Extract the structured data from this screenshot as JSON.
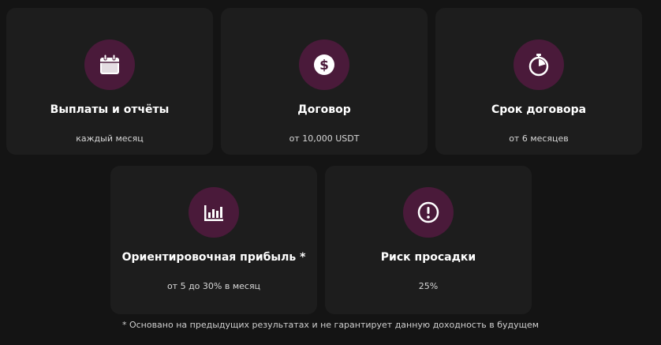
{
  "cards": [
    {
      "icon": "calendar-icon",
      "title": "Выплаты и отчёты",
      "subtitle": "каждый месяц"
    },
    {
      "icon": "dollar-coin-icon",
      "title": "Договор",
      "subtitle": "от 10,000 USDT"
    },
    {
      "icon": "stopwatch-icon",
      "title": "Срок договора",
      "subtitle": "от 6 месяцев"
    },
    {
      "icon": "bar-chart-icon",
      "title": "Ориентировочная прибыль *",
      "subtitle": "от 5 до 30% в месяц"
    },
    {
      "icon": "exclamation-icon",
      "title": "Риск просадки",
      "subtitle": "25%"
    }
  ],
  "footnote": "* Основано на предыдущих результатах и не гарантирует данную доходность в будущем",
  "colors": {
    "background": "#141414",
    "card": "#1d1d1d",
    "badge": "#4a1a3a",
    "text": "#ffffff"
  }
}
